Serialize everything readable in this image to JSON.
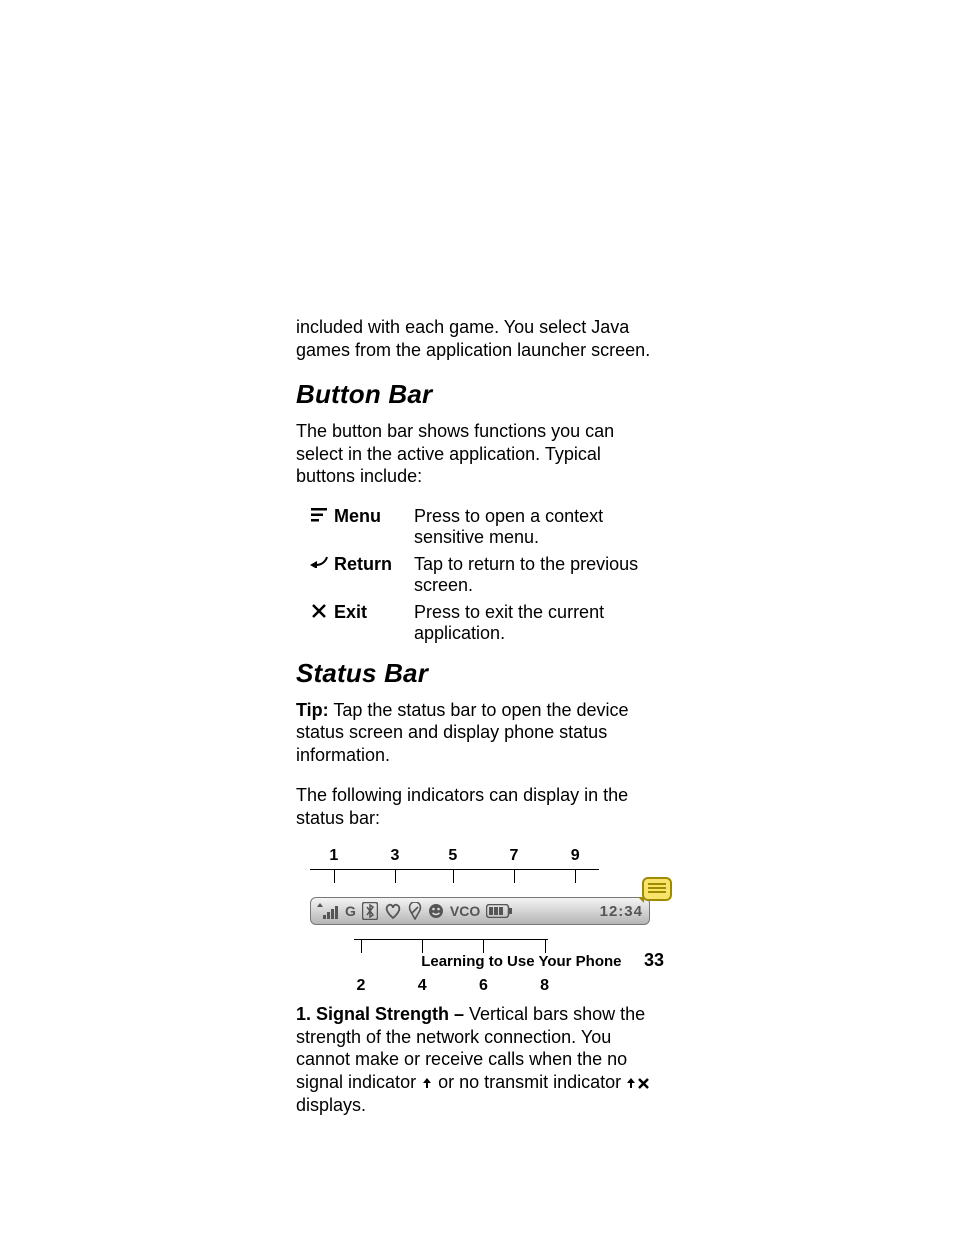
{
  "intro": "included with each game. You select Java games from the application launcher screen.",
  "section1": {
    "heading": "Button Bar",
    "intro": "The button bar shows functions you can select in the active application. Typical buttons include:",
    "rows": [
      {
        "icon": "menu-lines",
        "label": "Menu",
        "desc": "Press to open a context sensitive menu."
      },
      {
        "icon": "return-arrow",
        "label": "Return",
        "desc": "Tap to return to the previous screen."
      },
      {
        "icon": "x",
        "label": "Exit",
        "desc": "Press to exit the current application."
      }
    ]
  },
  "section2": {
    "heading": "Status Bar",
    "tip_label": "Tip:",
    "tip_text": " Tap the status bar to open the device status screen and display phone status information.",
    "lead": "The following indicators can display in the status bar:",
    "callouts_top": [
      "1",
      "3",
      "5",
      "7",
      "9"
    ],
    "callouts_bottom": [
      "2",
      "4",
      "6",
      "8"
    ],
    "status_items": {
      "gprs": "G",
      "vco": "VCO",
      "time": "12:34"
    },
    "item1_bold": "1. Signal Strength –",
    "item1_rest1": " Vertical bars show the strength of the network connection. You cannot make or receive calls when the no signal indicator ",
    "item1_rest2": " or no transmit indicator ",
    "item1_rest3": " displays."
  },
  "footer": {
    "text": "Learning to Use Your Phone",
    "page": "33"
  }
}
